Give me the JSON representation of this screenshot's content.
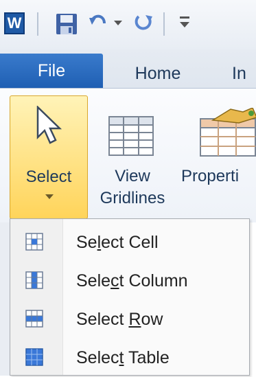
{
  "app": {
    "logo_letter": "W"
  },
  "tabs": [
    {
      "label": "File"
    },
    {
      "label": "Home"
    },
    {
      "label": "In"
    }
  ],
  "ribbon": {
    "select_label": "Select",
    "view_gridlines_label_1": "View",
    "view_gridlines_label_2": "Gridlines",
    "properties_label": "Properti"
  },
  "menu": {
    "items": [
      {
        "label_pre": "Se",
        "label_key": "l",
        "label_post": "ect Cell",
        "icon": "select-cell-icon"
      },
      {
        "label_pre": "Sele",
        "label_key": "c",
        "label_post": "t Column",
        "icon": "select-column-icon"
      },
      {
        "label_pre": "Select ",
        "label_key": "R",
        "label_post": "ow",
        "icon": "select-row-icon"
      },
      {
        "label_pre": "Selec",
        "label_key": "t",
        "label_post": " Table",
        "icon": "select-table-icon"
      }
    ]
  },
  "colors": {
    "file_tab": "#2a6cc0",
    "select_highlight": "#ffd45a",
    "text": "#1e395b"
  }
}
